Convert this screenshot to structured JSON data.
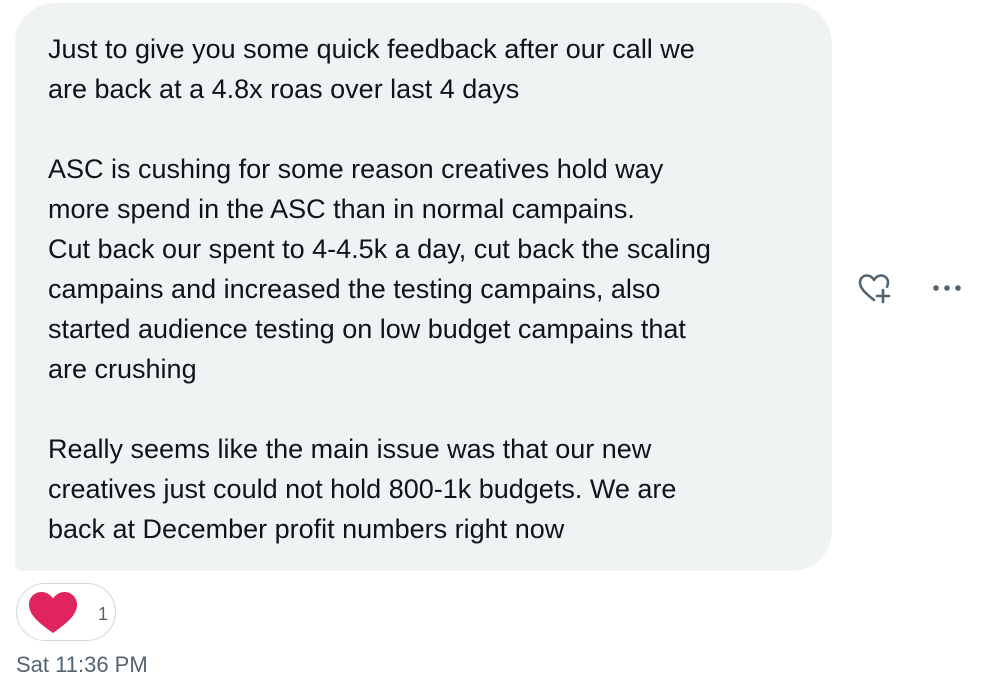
{
  "message": {
    "paragraphs": [
      {
        "lines": [
          "Just to give you some quick feedback after our call we",
          "are back at a 4.8x roas over last 4 days"
        ]
      },
      {
        "lines": [
          "ASC is cushing for some reason creatives hold way",
          "more spend in the ASC than in normal campains.",
          "Cut back our spent to 4-4.5k a day, cut back the scaling",
          "campains and increased the testing campains, also",
          "started audience testing on low budget campains that",
          "are crushing"
        ]
      },
      {
        "lines": [
          "Really seems like the main issue was that our new",
          "creatives just could not hold 800-1k budgets. We are",
          "back at December profit numbers right now"
        ]
      }
    ]
  },
  "actions": {
    "react_icon": "heart-plus-icon",
    "more_icon": "more-horizontal-icon"
  },
  "reaction": {
    "icon": "heart-icon",
    "count": "1",
    "color": "#e0245e"
  },
  "timestamp": "Sat 11:36 PM",
  "colors": {
    "bubble_bg": "#eff3f4",
    "text": "#0f1419",
    "secondary_text": "#536471",
    "border": "#cfd9de"
  }
}
